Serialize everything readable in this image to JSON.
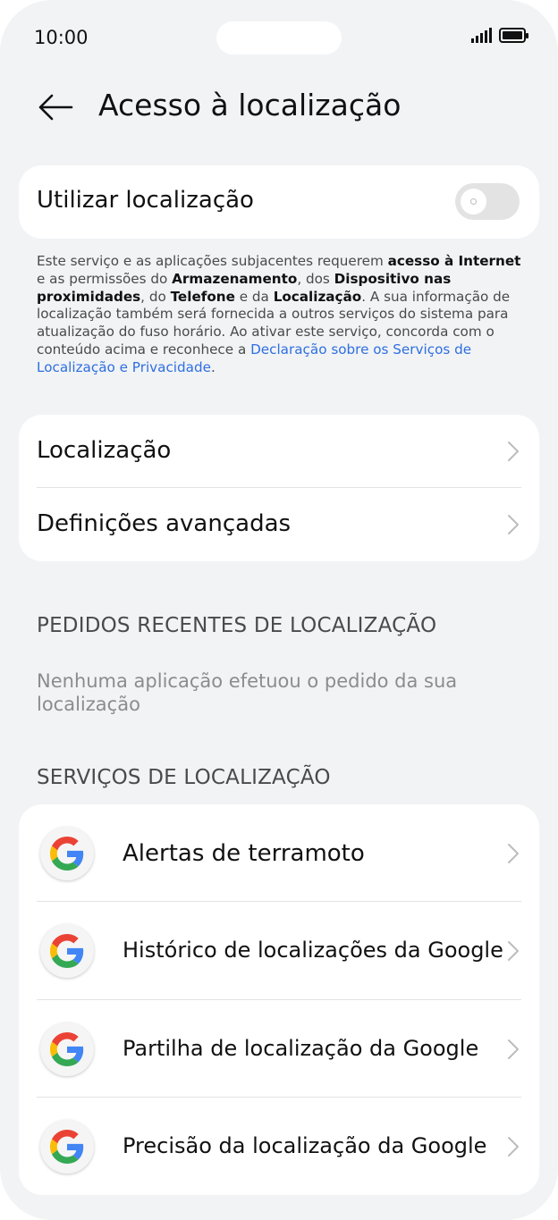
{
  "status_bar": {
    "time": "10:00"
  },
  "header": {
    "title": "Acesso à localização"
  },
  "use_location": {
    "label": "Utilizar localização",
    "toggle_state": "off"
  },
  "disclaimer": {
    "p1": "Este serviço e as aplicações subjacentes requerem ",
    "b1": "acesso à Internet",
    "p2": " e as permissões do ",
    "b2": "Armazenamento",
    "p3": ", dos ",
    "b3": "Dispositivo nas proximidades",
    "p4": ", do ",
    "b4": "Telefone",
    "p5": " e da ",
    "b5": "Localização",
    "p6": ". A sua informação de localização também será fornecida a outros serviços do sistema para atualização do fuso horário. Ao ativar este serviço, concorda com o conteúdo acima e reconhece a ",
    "link": "Declaração sobre os Serviços de Localização e Privacidade",
    "p7": "."
  },
  "settings": {
    "location": "Localização",
    "advanced": "Definições avançadas"
  },
  "recent_requests": {
    "title": "PEDIDOS RECENTES DE LOCALIZAÇÃO",
    "empty": "Nenhuma aplicação efetuou o pedido da sua localização"
  },
  "location_services": {
    "title": "SERVIÇOS DE LOCALIZAÇÃO",
    "items": [
      {
        "label": "Alertas de terramoto",
        "icon": "google-icon"
      },
      {
        "label": "Histórico de localizações da Google",
        "icon": "google-icon"
      },
      {
        "label": "Partilha de localização da Google",
        "icon": "google-icon"
      },
      {
        "label": "Precisão da localização da Google",
        "icon": "google-icon"
      }
    ]
  },
  "colors": {
    "background": "#f1f3f5",
    "card": "#ffffff",
    "link": "#2f6fe0",
    "toggle_off": "#e3e3e3"
  }
}
